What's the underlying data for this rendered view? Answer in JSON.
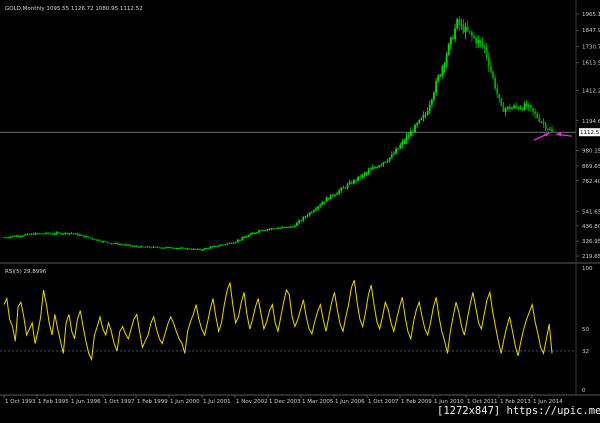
{
  "window": {
    "symbol": "GOLD,Monthly",
    "ohlc": "1095.55 1126.72 1080.95 1112.52",
    "indicator": "RSI(5) 29.8996"
  },
  "watermark": "[1272x847] https://upic.me/",
  "colors": {
    "background": "#000000",
    "candle_up": "#00e000",
    "candle_down": "#00a800",
    "rsi_line": "#e8d800",
    "price_line": "#b0b0b0",
    "level_line": "#6a7ab8",
    "arrow": "#ff22ff",
    "axis_text": "#cfcfcf"
  },
  "chart_data": [
    {
      "type": "candlestick",
      "price_ticks": [
        "1965.15",
        "1847.95",
        "1730.75",
        "1613.55",
        "1412.25",
        "1194.65",
        "980.15",
        "869.65",
        "762.40",
        "541.65",
        "436.80",
        "326.95",
        "219.65"
      ],
      "current_price": "1112.52",
      "anchors": [
        [
          "1993-10",
          355
        ],
        [
          "1995-01",
          380
        ],
        [
          "1996-06",
          385
        ],
        [
          "1997-10",
          320
        ],
        [
          "1999-02",
          285
        ],
        [
          "2000-06",
          280
        ],
        [
          "2001-07",
          265
        ],
        [
          "2002-11",
          320
        ],
        [
          "2003-12",
          410
        ],
        [
          "2005-03",
          430
        ],
        [
          "2006-06",
          620
        ],
        [
          "2007-10",
          780
        ],
        [
          "2009-02",
          940
        ],
        [
          "2010-06",
          1240
        ],
        [
          "2011-09",
          1900
        ],
        [
          "2012-10",
          1720
        ],
        [
          "2013-06",
          1280
        ],
        [
          "2014-06",
          1300
        ],
        [
          "2015-06",
          1112
        ]
      ],
      "ylim": [
        219.65,
        1965.15
      ]
    },
    {
      "type": "line",
      "yticks": [
        "100",
        "50",
        "32",
        "0"
      ],
      "level": 32,
      "ylim": [
        0,
        100
      ],
      "values": [
        70,
        75,
        58,
        52,
        40,
        68,
        72,
        60,
        45,
        50,
        55,
        38,
        48,
        60,
        82,
        70,
        55,
        45,
        62,
        50,
        40,
        30,
        55,
        62,
        48,
        42,
        58,
        65,
        52,
        40,
        30,
        25,
        45,
        52,
        60,
        50,
        45,
        55,
        48,
        38,
        32,
        48,
        52,
        46,
        42,
        50,
        58,
        62,
        48,
        35,
        40,
        45,
        55,
        60,
        50,
        42,
        38,
        46,
        54,
        60,
        55,
        48,
        42,
        38,
        30,
        48,
        56,
        62,
        70,
        58,
        50,
        45,
        55,
        66,
        75,
        60,
        48,
        55,
        70,
        82,
        88,
        70,
        55,
        60,
        72,
        80,
        62,
        50,
        58,
        68,
        75,
        62,
        50,
        56,
        65,
        70,
        55,
        48,
        60,
        72,
        82,
        78,
        60,
        52,
        58,
        66,
        74,
        60,
        50,
        46,
        56,
        64,
        70,
        58,
        48,
        60,
        72,
        80,
        66,
        54,
        48,
        60,
        70,
        84,
        90,
        72,
        58,
        52,
        64,
        78,
        86,
        70,
        56,
        50,
        60,
        72,
        66,
        55,
        48,
        58,
        68,
        76,
        60,
        48,
        42,
        56,
        66,
        72,
        60,
        50,
        45,
        55,
        68,
        76,
        60,
        48,
        40,
        30,
        48,
        60,
        72,
        64,
        52,
        45,
        58,
        70,
        80,
        68,
        55,
        50,
        62,
        74,
        80,
        64,
        52,
        40,
        30,
        42,
        52,
        60,
        48,
        36,
        28,
        40,
        50,
        58,
        64,
        70,
        56,
        46,
        35,
        30,
        42,
        54,
        30
      ],
      "x_labels": [
        "1 Oct 1993",
        "1 Feb 1995",
        "1 Jun 1996",
        "1 Oct 1997",
        "1 Feb 1999",
        "1 Jun 2000",
        "1 Jul 2001",
        "1 Nov 2002",
        "1 Dec 2003",
        "1 Mar 2005",
        "1 Jun 2006",
        "1 Oct 2007",
        "1 Feb 2009",
        "1 Jun 2010",
        "1 Oct 2011",
        "1 Feb 2013",
        "1 Jun 2014"
      ]
    }
  ]
}
